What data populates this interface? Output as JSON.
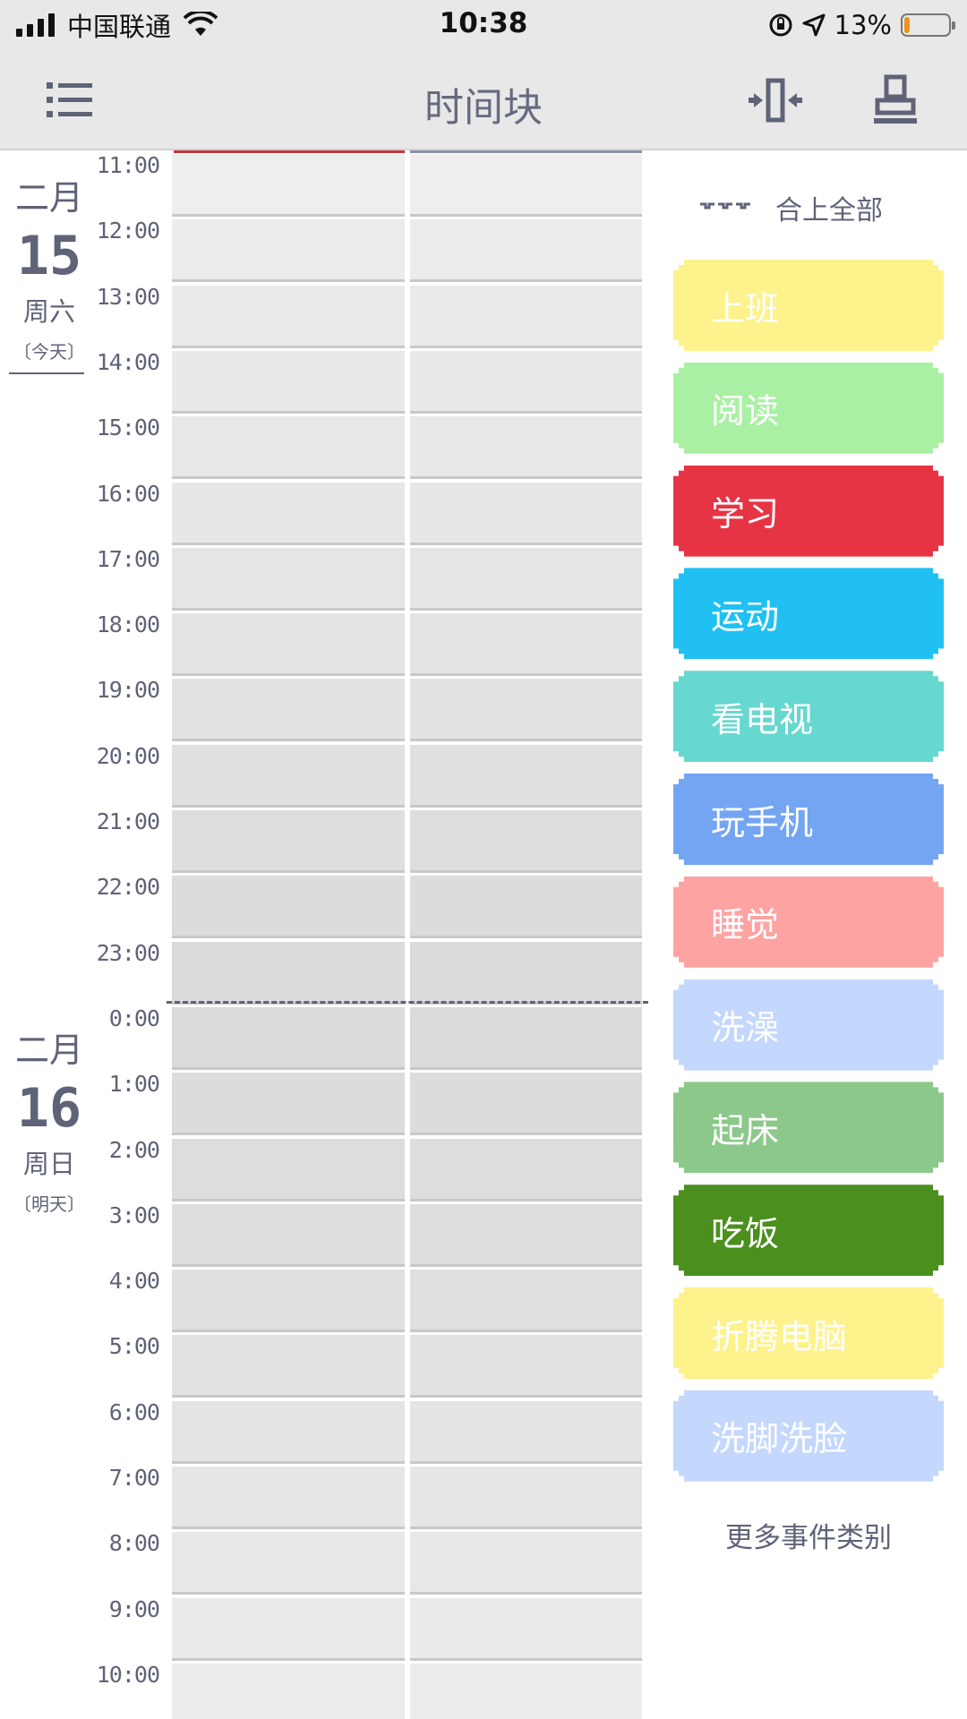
{
  "status_bar": {
    "carrier": "中国联通",
    "time": "10:38",
    "battery_percent": "13%",
    "battery_level": 0.13,
    "icons": [
      "signal-icon",
      "wifi-icon",
      "orientation-lock-icon",
      "location-arrow-icon",
      "battery-icon"
    ]
  },
  "header": {
    "title": "时间块",
    "left_icon": "menu-list-icon",
    "right_icons": [
      "zoom-width-icon",
      "stamp-icon"
    ]
  },
  "dates": [
    {
      "month": "二月",
      "day": "15",
      "weekday": "周六",
      "relative": "〔今天〕"
    },
    {
      "month": "二月",
      "day": "16",
      "weekday": "周日",
      "relative": "〔明天〕"
    }
  ],
  "hours": [
    "11:00",
    "12:00",
    "13:00",
    "14:00",
    "15:00",
    "16:00",
    "17:00",
    "18:00",
    "19:00",
    "20:00",
    "21:00",
    "22:00",
    "23:00",
    "0:00",
    "1:00",
    "2:00",
    "3:00",
    "4:00",
    "5:00",
    "6:00",
    "7:00",
    "8:00",
    "9:00",
    "10:00"
  ],
  "grid": {
    "cell_colors": [
      "#eeeeee",
      "#ececec",
      "#eaeaea",
      "#e9e9e9",
      "#e8e8e8",
      "#e7e7e7",
      "#e5e5e5",
      "#e4e4e4",
      "#e2e2e2",
      "#e0e0e0",
      "#dedede",
      "#dcdcdc",
      "#dbdbdb",
      "#dbdbdb",
      "#dcdcdc",
      "#dddddd",
      "#dedede",
      "#e0e0e0",
      "#e2e2e2",
      "#e4e4e4",
      "#e6e6e6",
      "#e8e8e8",
      "#eaeaea",
      "#ececec"
    ]
  },
  "panel": {
    "collapse_label": "合上全部",
    "collapse_icon": "collapse-dots-icon",
    "more_label": "更多事件类别",
    "categories": [
      {
        "label": "上班",
        "color": "#fdf28c"
      },
      {
        "label": "阅读",
        "color": "#aaf0a4"
      },
      {
        "label": "学习",
        "color": "#e73445"
      },
      {
        "label": "运动",
        "color": "#20c1f2"
      },
      {
        "label": "看电视",
        "color": "#66d8cf"
      },
      {
        "label": "玩手机",
        "color": "#73a5f3"
      },
      {
        "label": "睡觉",
        "color": "#fda3a2"
      },
      {
        "label": "洗澡",
        "color": "#c4d7fd"
      },
      {
        "label": "起床",
        "color": "#8cc88a"
      },
      {
        "label": "吃饭",
        "color": "#4b8f1e"
      },
      {
        "label": "折腾电脑",
        "color": "#fdf28c"
      },
      {
        "label": "洗脚洗脸",
        "color": "#c4d7fd"
      }
    ]
  }
}
